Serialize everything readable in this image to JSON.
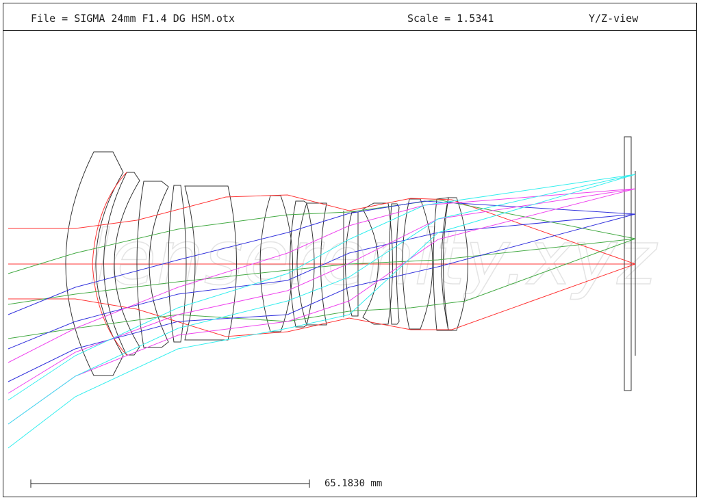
{
  "header": {
    "file": "File = SIGMA 24mm F1.4 DG HSM.otx",
    "scale": "Scale = 1.5341",
    "view": "Y/Z-view"
  },
  "scale_bar": {
    "label": "65.1830 mm"
  },
  "watermark": "lenserenity.xyz",
  "colors": {
    "outline": "#333333",
    "ray_axial": "#ff3333",
    "ray_field_1": "#44aa44",
    "ray_field_2": "#3333dd",
    "ray_field_3": "#ee44ee",
    "ray_field_4": "#33eeee"
  }
}
